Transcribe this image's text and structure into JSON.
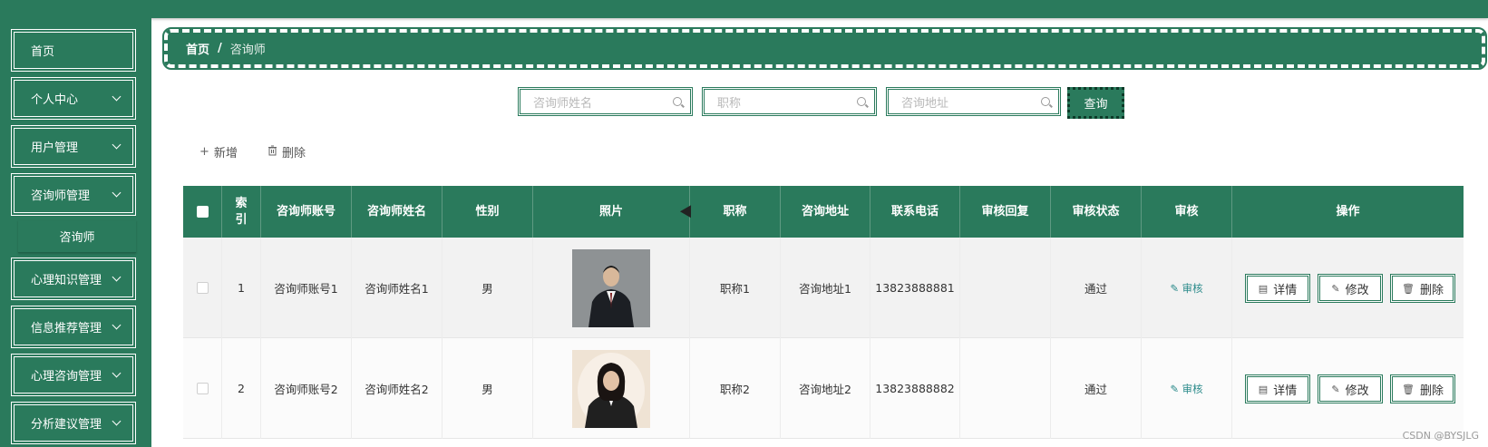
{
  "sidebar": {
    "items": [
      {
        "label": "首页",
        "has_arrow": false
      },
      {
        "label": "个人中心",
        "has_arrow": true
      },
      {
        "label": "用户管理",
        "has_arrow": true
      },
      {
        "label": "咨询师管理",
        "has_arrow": true
      },
      {
        "label": "心理知识管理",
        "has_arrow": true
      },
      {
        "label": "信息推荐管理",
        "has_arrow": true
      },
      {
        "label": "心理咨询管理",
        "has_arrow": true
      },
      {
        "label": "分析建议管理",
        "has_arrow": true
      }
    ],
    "sub_item": "咨询师"
  },
  "breadcrumb": {
    "home": "首页",
    "separator": "/",
    "current": "咨询师"
  },
  "search": {
    "name_placeholder": "咨询师姓名",
    "title_placeholder": "职称",
    "address_placeholder": "咨询地址",
    "button_label": "查询"
  },
  "actions": {
    "add_label": "新增",
    "delete_label": "删除"
  },
  "table": {
    "headers": [
      "索引",
      "咨询师账号",
      "咨询师姓名",
      "性别",
      "照片",
      "职称",
      "咨询地址",
      "联系电话",
      "审核回复",
      "审核状态",
      "审核",
      "操作"
    ],
    "index_header_top": "索",
    "index_header_bottom": "引",
    "rows": [
      {
        "index": "1",
        "account": "咨询师账号1",
        "name": "咨询师姓名1",
        "gender": "男",
        "title": "职称1",
        "address": "咨询地址1",
        "phone": "13823888881",
        "reply": "",
        "status": "通过",
        "audit": "审核"
      },
      {
        "index": "2",
        "account": "咨询师账号2",
        "name": "咨询师姓名2",
        "gender": "男",
        "title": "职称2",
        "address": "咨询地址2",
        "phone": "13823888882",
        "reply": "",
        "status": "通过",
        "audit": "审核"
      }
    ],
    "op_buttons": {
      "detail": "详情",
      "edit": "修改",
      "delete": "删除"
    }
  },
  "watermark": "CSDN @BYSJLG",
  "colors": {
    "primary": "#2a7a5c",
    "audit_link": "#2a8a8a"
  }
}
